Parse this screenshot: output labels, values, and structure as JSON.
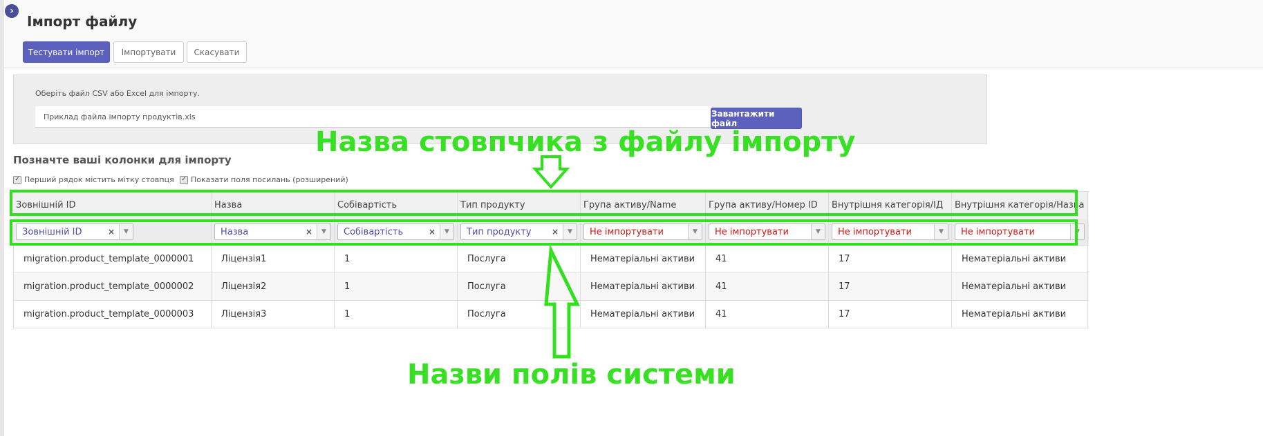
{
  "page": {
    "title": "Імпорт файлу",
    "sidebar_toggle_icon": "chevron-right-icon",
    "sidebar_toggle_glyph": "›"
  },
  "toolbar": {
    "test_import_label": "Тестувати імпорт",
    "import_label": "Імпортувати",
    "cancel_label": "Скасувати"
  },
  "file": {
    "hint": "Оберіть файл CSV або Excel для імпорту.",
    "filename": "Приклад файла імпорту продуктів.xls",
    "upload_label": "Завантажити файл"
  },
  "mapping": {
    "section_title": "Позначте ваші колонки для імпорту",
    "option_first_row": "Перший рядок містить мітку стовпця",
    "option_show_links": "Показати поля посилань (розширений)",
    "option_first_row_checked": true,
    "option_show_links_checked": true
  },
  "columns": [
    {
      "header": "Зовнішній ID",
      "field": "Зовнішній ID",
      "status": "mapped"
    },
    {
      "header": "Назва",
      "field": "Назва",
      "status": "mapped"
    },
    {
      "header": "Собівартість",
      "field": "Собівартість",
      "status": "mapped"
    },
    {
      "header": "Тип продукту",
      "field": "Тип продукту",
      "status": "mapped"
    },
    {
      "header": "Група активу/Name",
      "field": "Не імпортувати",
      "status": "ignored"
    },
    {
      "header": "Група активу/Номер ID",
      "field": "Не імпортувати",
      "status": "ignored"
    },
    {
      "header": "Внутрішня категорія/ІД",
      "field": "Не імпортувати",
      "status": "ignored"
    },
    {
      "header": "Внутрішня категорія/Назва",
      "field": "Не імпортувати",
      "status": "ignored"
    }
  ],
  "rows": [
    [
      "migration.product_template_0000001",
      "Ліцензія1",
      "1",
      "Послуга",
      "Нематеріальні активи",
      "41",
      "17",
      "Нематеріальні активи"
    ],
    [
      "migration.product_template_0000002",
      "Ліцензія2",
      "1",
      "Послуга",
      "Нематеріальні активи",
      "41",
      "17",
      "Нематеріальні активи"
    ],
    [
      "migration.product_template_0000003",
      "Ліцензія3",
      "1",
      "Послуга",
      "Нематеріальні активи",
      "41",
      "17",
      "Нематеріальні активи"
    ]
  ],
  "annotations": {
    "file_columns_label": "Назва стовпчика з файлу імпорту",
    "system_fields_label": "Назви полів системи",
    "color": "#33e01f"
  },
  "theme": {
    "primary": "#5b61bd",
    "mapped_text": "#4b4fa8",
    "ignored_text": "#d01717"
  },
  "icons": {
    "clear": "close-icon",
    "dropdown": "chevron-down-icon",
    "checkbox": "check-icon"
  }
}
